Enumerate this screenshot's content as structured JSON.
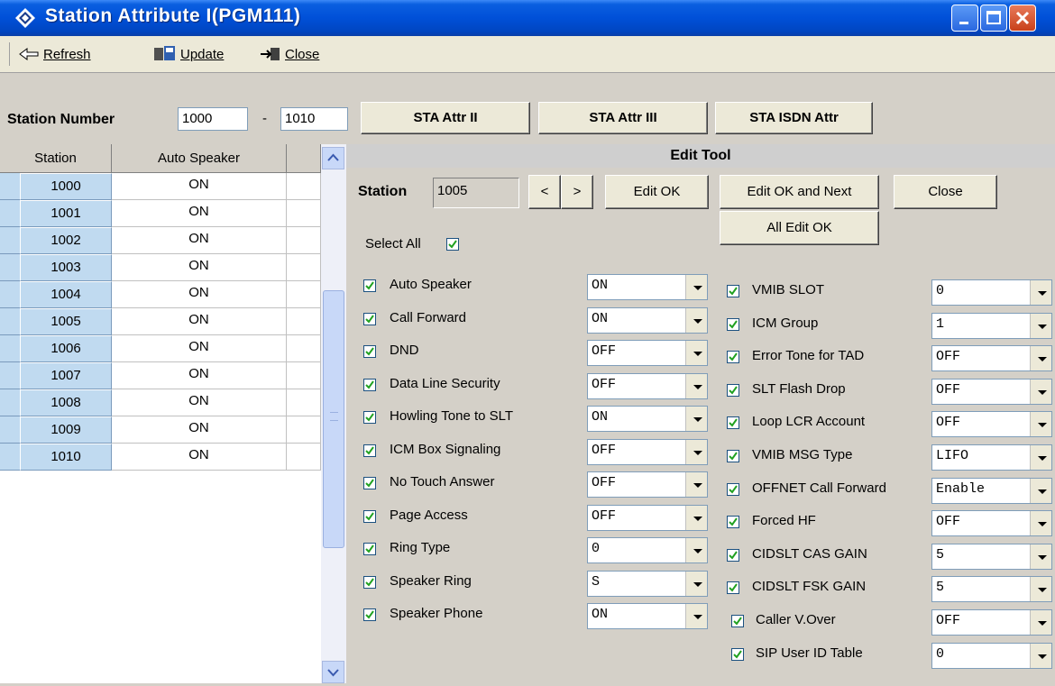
{
  "window": {
    "title": "Station Attribute I(PGM111)"
  },
  "toolbar": {
    "refresh": "Refresh",
    "update": "Update",
    "close": "Close"
  },
  "filter": {
    "label": "Station Number",
    "from": "1000",
    "dash": "-",
    "to": "1010",
    "btn_attr2": "STA Attr II",
    "btn_attr3": "STA Attr III",
    "btn_isdn": "STA ISDN Attr"
  },
  "grid": {
    "col_station": "Station",
    "col_auto": "Auto Speaker",
    "rows": [
      {
        "station": "1000",
        "value": "ON"
      },
      {
        "station": "1001",
        "value": "ON"
      },
      {
        "station": "1002",
        "value": "ON"
      },
      {
        "station": "1003",
        "value": "ON"
      },
      {
        "station": "1004",
        "value": "ON"
      },
      {
        "station": "1005",
        "value": "ON"
      },
      {
        "station": "1006",
        "value": "ON"
      },
      {
        "station": "1007",
        "value": "ON"
      },
      {
        "station": "1008",
        "value": "ON"
      },
      {
        "station": "1009",
        "value": "ON"
      },
      {
        "station": "1010",
        "value": "ON"
      }
    ]
  },
  "edit": {
    "header": "Edit Tool",
    "station_label": "Station",
    "station_value": "1005",
    "prev": "<",
    "next": ">",
    "edit_ok": "Edit OK",
    "edit_ok_next": "Edit OK and Next",
    "close": "Close",
    "all_edit_ok": "All Edit OK",
    "select_all": "Select All",
    "left_options": [
      {
        "label": "Auto Speaker",
        "value": "ON"
      },
      {
        "label": "Call Forward",
        "value": "ON"
      },
      {
        "label": "DND",
        "value": "OFF"
      },
      {
        "label": "Data Line Security",
        "value": "OFF"
      },
      {
        "label": "Howling Tone to SLT",
        "value": "ON"
      },
      {
        "label": "ICM Box Signaling",
        "value": "OFF"
      },
      {
        "label": "No Touch Answer",
        "value": "OFF"
      },
      {
        "label": "Page Access",
        "value": "OFF"
      },
      {
        "label": "Ring Type",
        "value": "0"
      },
      {
        "label": "Speaker Ring",
        "value": "S"
      },
      {
        "label": "Speaker Phone",
        "value": "ON"
      }
    ],
    "right_options": [
      {
        "label": "VMIB SLOT",
        "value": "0"
      },
      {
        "label": "ICM Group",
        "value": "1"
      },
      {
        "label": "Error Tone for TAD",
        "value": "OFF"
      },
      {
        "label": "SLT Flash Drop",
        "value": "OFF"
      },
      {
        "label": "Loop LCR Account",
        "value": "OFF"
      },
      {
        "label": "VMIB MSG Type",
        "value": "LIFO"
      },
      {
        "label": "OFFNET Call Forward",
        "value": "Enable"
      },
      {
        "label": "Forced HF",
        "value": "OFF"
      },
      {
        "label": "CIDSLT CAS GAIN",
        "value": "5"
      },
      {
        "label": "CIDSLT FSK GAIN",
        "value": "5"
      },
      {
        "label": "Caller V.Over",
        "value": "OFF"
      },
      {
        "label": "SIP User ID Table",
        "value": "0"
      }
    ]
  }
}
